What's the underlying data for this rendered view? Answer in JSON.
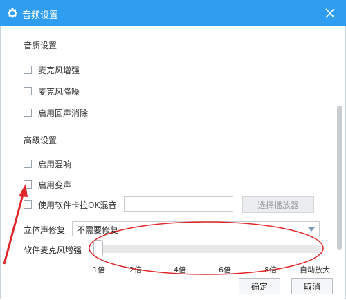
{
  "window": {
    "title": "音频设置"
  },
  "quality": {
    "heading": "音质设置",
    "options": [
      {
        "label": "麦克风增强",
        "checked": false
      },
      {
        "label": "麦克风降噪",
        "checked": false
      },
      {
        "label": "启用回声消除",
        "checked": false
      }
    ]
  },
  "advanced": {
    "heading": "高级设置",
    "options": [
      {
        "label": "启用混响",
        "checked": false
      },
      {
        "label": "启用变声",
        "checked": false
      }
    ],
    "ktv": {
      "label": "使用软件卡拉OK混音",
      "checked": false,
      "input_value": "",
      "choose_button": "选择播放器"
    },
    "stereo": {
      "label": "立体声修复",
      "selected": "不需要修复"
    },
    "mic_boost": {
      "label": "软件麦克风增强",
      "value": "1倍",
      "ticks": [
        "1倍",
        "2倍",
        "4倍",
        "6倍",
        "8倍",
        "自动放大"
      ]
    }
  },
  "footer": {
    "ok_label": "确定",
    "cancel_label": "取消"
  },
  "colors": {
    "titlebar": "#2f9ef0",
    "annotation": "#e0282a"
  }
}
